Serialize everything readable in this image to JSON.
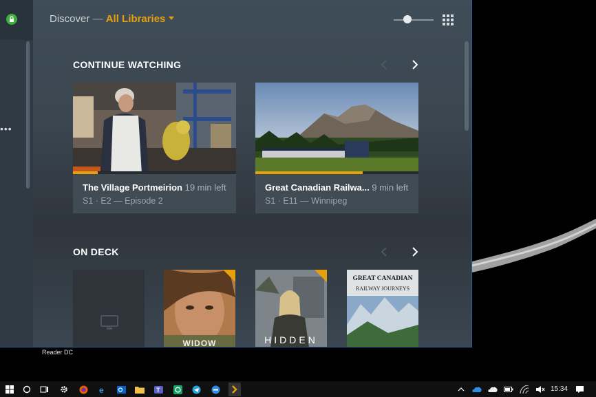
{
  "header": {
    "discover": "Discover",
    "separator": "—",
    "library": "All Libraries"
  },
  "continue_watching": {
    "title": "CONTINUE WATCHING",
    "items": [
      {
        "title": "The Village Portmeirion",
        "time_left": "19 min left",
        "episode": "S1 · E2 — Episode 2",
        "progress": 0.15
      },
      {
        "title": "Great Canadian Railwa...",
        "time_left": "9 min left",
        "episode": "S1 · E11 — Winnipeg",
        "progress": 0.66
      }
    ]
  },
  "on_deck": {
    "title": "ON DECK",
    "posters": [
      {
        "text": ""
      },
      {
        "text": "WIDOW"
      },
      {
        "text": "HIDDEN"
      },
      {
        "text_top": "GREAT CANADIAN",
        "text_bottom": "RAILWAY JOURNEYS"
      }
    ]
  },
  "desktop": {
    "app_label": "Reader DC"
  },
  "taskbar": {
    "time": "15:34"
  },
  "colors": {
    "accent": "#e5a00d",
    "lock_green": "#3fae3f"
  }
}
